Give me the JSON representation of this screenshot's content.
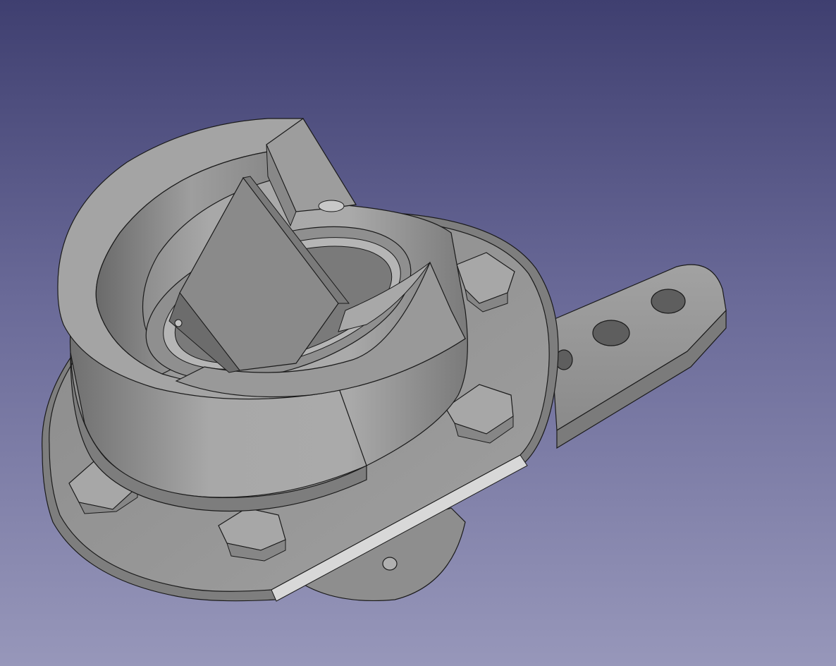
{
  "viewport": {
    "background_top": "#3f3f70",
    "background_bottom": "#9797ba"
  },
  "model": {
    "colors": {
      "body": "#9a9a9a",
      "body_light": "#b8b8b8",
      "body_dark": "#6e6e6e",
      "edge": "#1a1a1a"
    },
    "features": [
      "mounting-flange",
      "hex-bolt-1",
      "hex-bolt-2",
      "hex-bolt-3",
      "hex-bolt-4",
      "cylindrical-housing",
      "inner-ring",
      "blade-plate",
      "side-arm-with-three-holes"
    ]
  }
}
